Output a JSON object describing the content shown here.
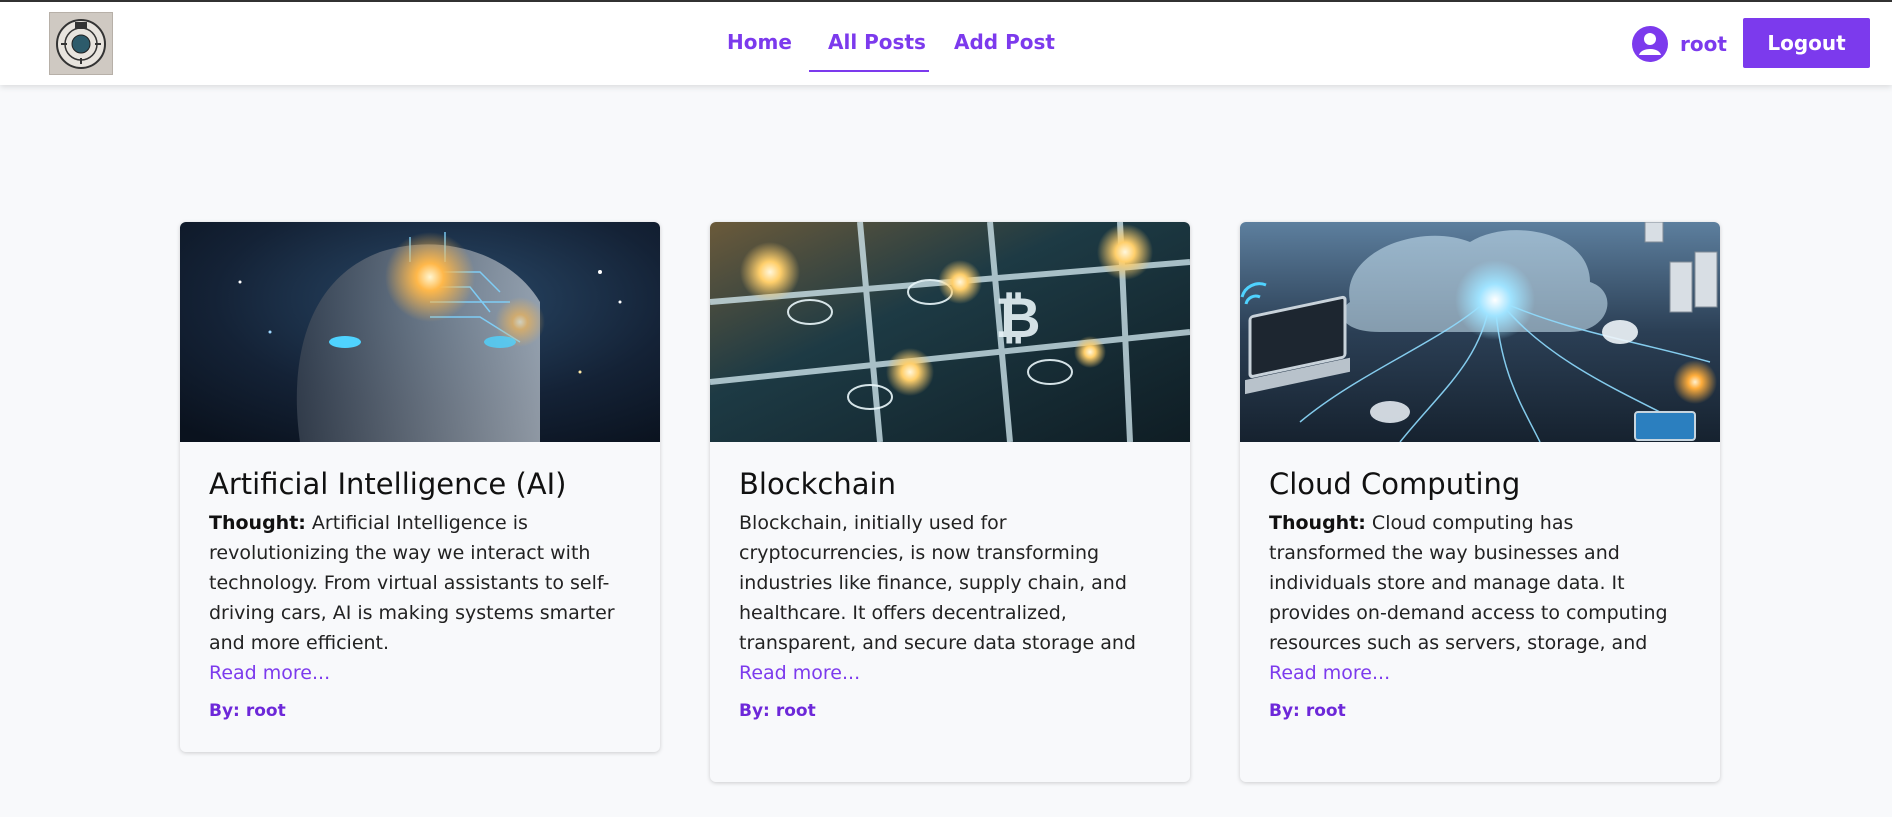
{
  "nav": {
    "home": "Home",
    "all_posts": "All Posts",
    "add_post": "Add Post"
  },
  "user": {
    "name": "root",
    "icon": "user-circle-icon"
  },
  "logout_label": "Logout",
  "colors": {
    "accent": "#7c3aed",
    "background": "#f8f9fb"
  },
  "posts": [
    {
      "title": "Artificial Intelligence (AI)",
      "label": "Thought:",
      "text": "Artificial Intelligence is revolutionizing the way we interact with technology. From virtual assistants to self-driving cars, AI is making systems smarter and more efficient.",
      "read_more": "Read more...",
      "by_label": "By:",
      "author": "root",
      "image": "ai-brain-image"
    },
    {
      "title": "Blockchain",
      "label": "",
      "text": "Blockchain, initially used for cryptocurrencies, is now transforming industries like finance, supply chain, and healthcare. It offers decentralized, transparent, and secure data storage and transactions, reducing fraud and streamlining processes, ensuring trust without a central",
      "read_more": "Read more...",
      "by_label": "By:",
      "author": "root",
      "image": "blockchain-image"
    },
    {
      "title": "Cloud Computing",
      "label": "Thought:",
      "text": "Cloud computing has transformed the way businesses and individuals store and manage data. It provides on-demand access to computing resources such as servers, storage, and software, reducing the need for expensive infrastructure. With cloud services like AWS,",
      "read_more": "Read more...",
      "by_label": "By:",
      "author": "root",
      "image": "cloud-computing-image"
    }
  ]
}
